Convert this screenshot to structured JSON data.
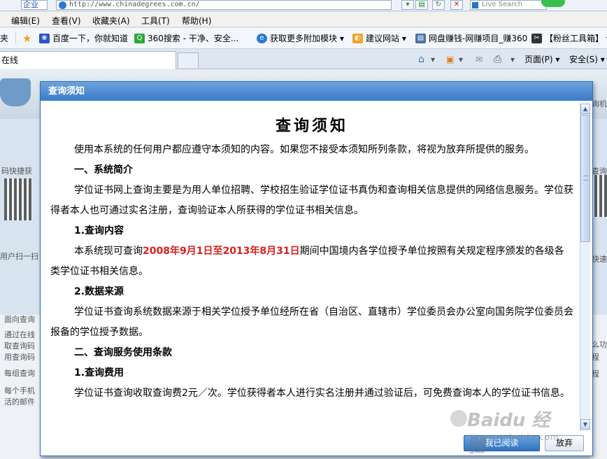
{
  "browser": {
    "address_mode": "企业",
    "url": "http://www.chinadegrees.com.cn/",
    "search_placeholder": "Live Search",
    "menu": [
      "编辑(E)",
      "查看(V)",
      "收藏夹(A)",
      "工具(T)",
      "帮助(H)"
    ],
    "fav_fragment": "夹",
    "favorites": [
      {
        "label": "百度一下，你就知道",
        "icon": "baidu-paw-icon",
        "color": "#2b52c9"
      },
      {
        "label": "360搜索 - 干净、安全...",
        "icon": "search-360-icon",
        "color": "#2ca83a"
      },
      {
        "label": "获取更多附加模块 ▾",
        "icon": "ie-logo-icon",
        "color": "#2b78d6"
      },
      {
        "label": "建议网站 ▾",
        "icon": "suggested-sites-icon",
        "color": "#f2a428"
      },
      {
        "label": "网盘赚钱-网赚项目_赚360",
        "icon": "page-icon",
        "color": "#4a6fa8"
      },
      {
        "label": "【粉丝工具箱】 ▾",
        "icon": "tools-icon",
        "color": "#333333"
      }
    ],
    "tab_label": "在线",
    "commands": {
      "page": "页面(P) ▾",
      "safety": "安全(S) ▾"
    }
  },
  "background_page": {
    "left_texts": [
      "码快捷获",
      "用户扫一扫",
      "面向查询",
      "通过在线",
      "取查询码",
      "用查询码",
      "每组查询",
      "每个手机",
      "活的邮件"
    ],
    "right_texts": [
      "询机",
      "查询",
      "快速",
      "么功",
      "程",
      "程"
    ]
  },
  "dialog": {
    "title": "查询须知",
    "doc_title": "查询须知",
    "intro": "使用本系统的任何用户都应遵守本须知的内容。如果您不接受本须知所列条款，将视为放弃所提供的服务。",
    "section1_heading": "一、系统简介",
    "section1_text": "学位证书网上查询主要是为用人单位招聘、学校招生验证学位证书真伪和查询相关信息提供的网络信息服务。学位获得者本人也可通过实名注册，查询验证本人所获得的学位证书相关信息。",
    "sub1_heading": "1.查询内容",
    "sub1_text_before": "本系统现可查询",
    "sub1_text_red": "2008年9月1日至2013年8月31日",
    "sub1_text_after": "期间中国境内各学位授予单位按照有关规定程序颁发的各级各类学位证书相关信息。",
    "sub2_heading": "2.数据来源",
    "sub2_text": "学位证书查询系统数据来源于相关学位授予单位经所在省（自治区、直辖市）学位委员会办公室向国务院学位委员会报备的学位授予数据。",
    "section2_heading": "二、查询服务使用条款",
    "sub3_heading": "1.查询费用",
    "sub3_text": "学位证书查询收取查询费2元／次。学位获得者本人进行实名注册并通过验证后，可免费查询本人的学位证书信息。",
    "agree_label": "我已阅读",
    "quit_label": "放弃"
  },
  "watermark": {
    "big": "Baidu 经验",
    "small": "jingyan.baidu.com"
  }
}
